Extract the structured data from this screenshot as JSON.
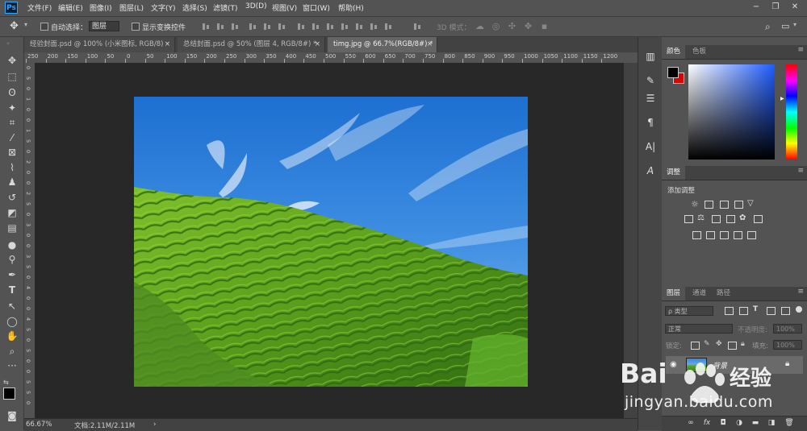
{
  "menubar": {
    "logo": "Ps",
    "items": [
      "文件(F)",
      "编辑(E)",
      "图像(I)",
      "图层(L)",
      "文字(Y)",
      "选择(S)",
      "滤镜(T)",
      "3D(D)",
      "视图(V)",
      "窗口(W)",
      "帮助(H)"
    ],
    "window_controls": [
      "−",
      "❐",
      "✕"
    ]
  },
  "options": {
    "auto_select": "自动选择：",
    "layer_select": "图层",
    "show_transform": "显示变换控件",
    "mode_3d": "3D 模式："
  },
  "tabs": [
    {
      "label": "经验封面.psd @ 100% (小米图标, RGB/8)",
      "close": "×",
      "active": false
    },
    {
      "label": "总结封面.psd @ 50% (图层 4, RGB/8#) *",
      "close": "×",
      "active": false
    },
    {
      "label": "timg.jpg @ 66.7%(RGB/8#) *",
      "close": "×",
      "active": true
    }
  ],
  "ruler_h": [
    "250",
    "200",
    "150",
    "100",
    "50",
    "0",
    "50",
    "100",
    "150",
    "200",
    "250",
    "300",
    "350",
    "400",
    "450",
    "500",
    "550",
    "600",
    "650",
    "700",
    "750",
    "800",
    "850",
    "900",
    "950",
    "1000",
    "1050",
    "1100",
    "1150",
    "1200"
  ],
  "ruler_v": [
    "0",
    "5",
    "0",
    "1",
    "0",
    "0",
    "1",
    "5",
    "0",
    "2",
    "0",
    "0",
    "2",
    "5",
    "0",
    "3",
    "0",
    "0",
    "3",
    "5",
    "0",
    "4",
    "0",
    "0",
    "4",
    "5",
    "0",
    "5",
    "0",
    "0",
    "5",
    "5",
    "0"
  ],
  "status": {
    "zoom": "66.67%",
    "doc": "文档:2.11M/2.11M",
    "arrow": "›"
  },
  "color_panel": {
    "tabs": [
      "颜色",
      "色板"
    ],
    "foreground": "#000000",
    "background": "#e10000"
  },
  "adjust_panel": {
    "tab": "调整",
    "title": "添加调整"
  },
  "layers_panel": {
    "tabs": [
      "图层",
      "通道",
      "路径"
    ],
    "filter": "ρ 类型",
    "blend_mode": "正常",
    "opacity_label": "不透明度:",
    "opacity_value": "100%",
    "lock_label": "锁定:",
    "fill_label": "填充:",
    "fill_value": "100%",
    "layer_name": "背景"
  },
  "panel_menu": "≡",
  "watermark": {
    "brand": "Bai",
    "brand_suffix": "经验",
    "url": "jingyan.baidu.com"
  }
}
